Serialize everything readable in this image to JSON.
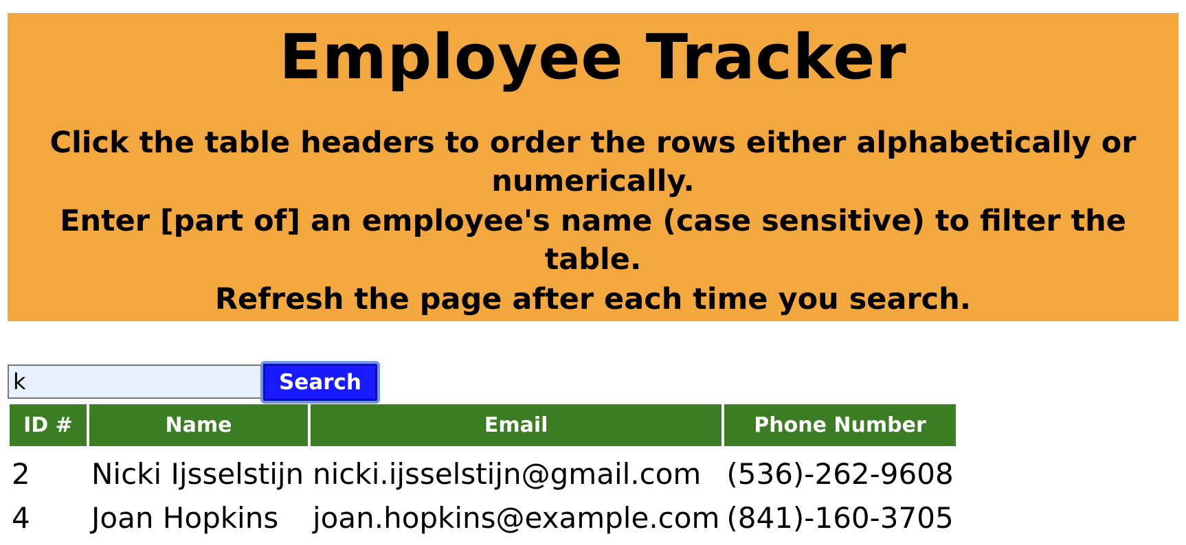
{
  "header": {
    "title": "Employee Tracker",
    "instructions": [
      "Click the table headers to order the rows either alphabetically or numerically.",
      "Enter [part of] an employee's name (case sensitive) to filter the table.",
      "Refresh the page after each time you search."
    ]
  },
  "search": {
    "value": "k",
    "button_label": "Search"
  },
  "table": {
    "headers": [
      "ID #",
      "Name",
      "Email",
      "Phone Number"
    ],
    "rows": [
      [
        "2",
        "Nicki Ijsselstijn",
        "nicki.ijsselstijn@gmail.com",
        "(536)-262-9608"
      ],
      [
        "4",
        "Joan Hopkins",
        "joan.hopkins@example.com",
        "(841)-160-3705"
      ]
    ]
  },
  "colors": {
    "banner": "#f2a83f",
    "header_cells": "#3a7d22",
    "search_button": "#1a1aff"
  }
}
